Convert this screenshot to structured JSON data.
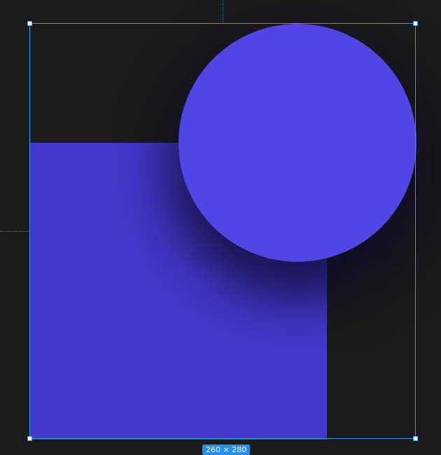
{
  "canvas": {
    "background_color": "#1b1b1b"
  },
  "shapes": {
    "rectangle_color": "#4338ca",
    "circle_color": "#4f46e5"
  },
  "selection": {
    "color": "#2d9cf0",
    "size_label": "260 × 280"
  }
}
